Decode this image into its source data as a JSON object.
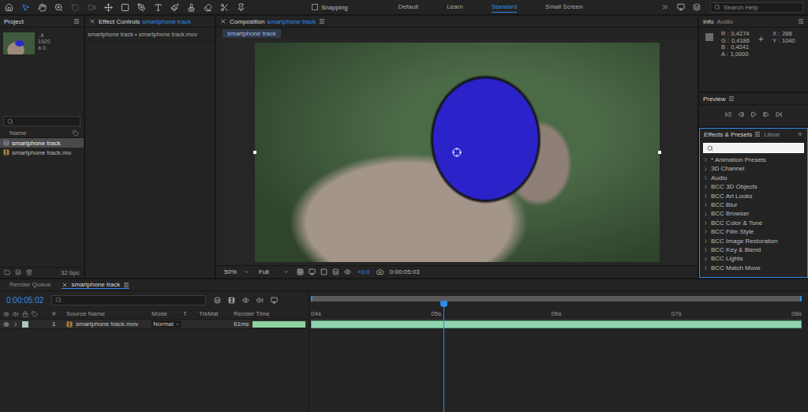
{
  "toolbar": {
    "tools": [
      {
        "selected": false,
        "disabled": false
      },
      {
        "selected": true,
        "disabled": false
      },
      {
        "selected": false,
        "disabled": false
      },
      {
        "selected": false,
        "disabled": false
      },
      {
        "selected": false,
        "disabled": true
      },
      {
        "selected": false,
        "disabled": true
      },
      {
        "selected": false,
        "disabled": false
      },
      {
        "selected": false,
        "disabled": false
      },
      {
        "selected": false,
        "disabled": false
      },
      {
        "selected": false,
        "disabled": false
      },
      {
        "selected": false,
        "disabled": false
      },
      {
        "selected": false,
        "disabled": false
      },
      {
        "selected": false,
        "disabled": false
      },
      {
        "selected": false,
        "disabled": false
      },
      {
        "selected": false,
        "disabled": false
      }
    ],
    "snapping": {
      "label": "Snapping",
      "checked": false
    },
    "workspaces": [
      {
        "label": "Default",
        "selected": false
      },
      {
        "label": "Learn",
        "selected": false
      },
      {
        "label": "Standard",
        "selected": true
      },
      {
        "label": "Small Screen",
        "selected": false
      }
    ],
    "search": {
      "placeholder": "Search Help"
    }
  },
  "project": {
    "title": "Project",
    "thumbnail_info": [
      "..k",
      "1920",
      "a 0."
    ],
    "columns": [
      "Name"
    ],
    "items": [
      {
        "name": "smartphone track",
        "kind": "comp",
        "selected": true
      },
      {
        "name": "smartphone track.mo",
        "kind": "footage",
        "selected": false
      }
    ],
    "bpc": "32 bpc"
  },
  "effect_controls": {
    "title": "Effect Controls",
    "target": "smartphone track",
    "subtitle": "smartphone track • smartphone track.mov"
  },
  "composition": {
    "title": "Composition",
    "target": "smartphone track",
    "viewer_tab": "smartphone track",
    "zoom": "50%",
    "resolution": "Full",
    "exposure": "+0.0",
    "timecode": "0:00:05:03"
  },
  "info": {
    "tabs": [
      {
        "label": "Info",
        "selected": true
      },
      {
        "label": "Audio",
        "selected": false
      }
    ],
    "values": [
      {
        "label": "R :",
        "value": "0,4274"
      },
      {
        "label": "G :",
        "value": "0,4186"
      },
      {
        "label": "B :",
        "value": "0,4241"
      },
      {
        "label": "A :",
        "value": "1,0000"
      }
    ],
    "coords": [
      {
        "label": "X :",
        "value": "288"
      },
      {
        "label": "Y :",
        "value": "1040"
      }
    ]
  },
  "preview": {
    "title": "Preview"
  },
  "effects": {
    "tabs": [
      {
        "label": "Effects & Presets",
        "selected": true
      },
      {
        "label": "Librar",
        "selected": false
      }
    ],
    "items": [
      {
        "label": "* Animation Presets",
        "expanded": false
      },
      {
        "label": "3D Channel",
        "expanded": false
      },
      {
        "label": "Audio",
        "expanded": false
      },
      {
        "label": "BCC 3D Objects",
        "expanded": false
      },
      {
        "label": "BCC Art Looks",
        "expanded": false
      },
      {
        "label": "BCC Blur",
        "expanded": false
      },
      {
        "label": "BCC Browser",
        "expanded": false
      },
      {
        "label": "BCC Color & Tone",
        "expanded": false
      },
      {
        "label": "BCC Film Style",
        "expanded": false
      },
      {
        "label": "BCC Image Restoration",
        "expanded": false
      },
      {
        "label": "BCC Key & Blend",
        "expanded": false
      },
      {
        "label": "BCC Lights",
        "expanded": false
      },
      {
        "label": "BCC Match Move",
        "expanded": false
      }
    ]
  },
  "timeline": {
    "tabs": [
      {
        "label": "Render Queue",
        "selected": false
      },
      {
        "label": "smartphone track",
        "selected": true
      }
    ],
    "timecode": "0:00:05:02",
    "columns": [
      "#",
      "Source Name",
      "Mode",
      "T",
      "TrkMat",
      "Render Time"
    ],
    "layers": [
      {
        "index": "1",
        "name": "smartphone track.mov",
        "mode": "Normal",
        "render_time": "61ms",
        "render_level": 1,
        "visible": true,
        "expanded": false,
        "color": "#a9c8bd"
      }
    ],
    "ruler": [
      "04s",
      "05s",
      "06s",
      "07s",
      "08s"
    ],
    "playhead": {
      "level": 0.27
    }
  }
}
